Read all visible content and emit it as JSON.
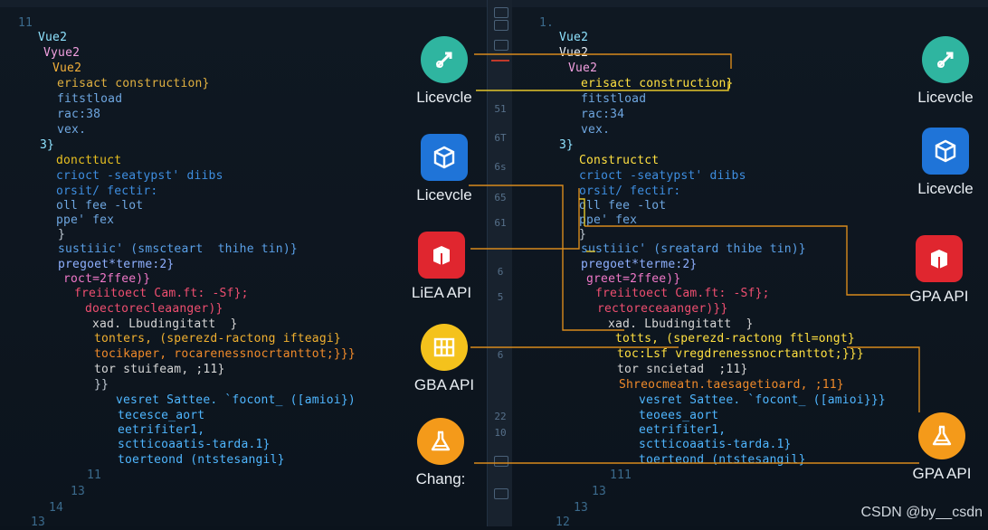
{
  "colors": {
    "background": "#0b131c",
    "orange_line": "#d88a1c",
    "yellow_line": "#e3c62a"
  },
  "left_code": [
    {
      "text": "11",
      "color": "#3b6a8c"
    },
    {
      "text": "Vue2",
      "color": "#8fe3ff"
    },
    {
      "text": "Vyue2",
      "color": "#f2a0e0"
    },
    {
      "text": "Vue2",
      "color": "#f5b13a"
    },
    {
      "text": "erisact construction}",
      "color": "#e0b040"
    },
    {
      "text": "fitstload",
      "color": "#6ea6e0"
    },
    {
      "text": "rac:38",
      "color": "#6ea6e0"
    },
    {
      "text": "vex.",
      "color": "#6ea6e0"
    },
    {
      "text": "3}",
      "color": "#8fe3ff"
    },
    {
      "text": "doncttuct",
      "color": "#e8c020"
    },
    {
      "text": "crioct -seatypst' diibs",
      "color": "#3e8ee0"
    },
    {
      "text": "orsit/ fectir:",
      "color": "#3e8ee0"
    },
    {
      "text": "oll fee -lot",
      "color": "#6ea6e0"
    },
    {
      "text": "ppe' fex",
      "color": "#6ea6e0"
    },
    {
      "text": "}",
      "color": "#bfc8d2"
    },
    {
      "text": "sustiiic' (smscteart  thihe tin)}",
      "color": "#5aa0e8"
    },
    {
      "text": "pregoet*terme:2}",
      "color": "#8fb0ff"
    },
    {
      "text": "roct=2ffee)}",
      "color": "#f078c8"
    },
    {
      "text": "freiitoect Cam.ft: -Sf};",
      "color": "#ef4f70"
    },
    {
      "text": "doectorecleaanger)}",
      "color": "#ef4f70"
    },
    {
      "text": "xad. Lbudingitatt  }",
      "color": "#d6d6d6"
    },
    {
      "text": "tonters, (sperezd-ractong ifteagi}",
      "color": "#f0b030"
    },
    {
      "text": "tocikaper, rocarenessnocrtanttot;}}}",
      "color": "#f08a2a"
    },
    {
      "text": "tor stuifeam, ;11}",
      "color": "#d6d6d6"
    },
    {
      "text": "}}",
      "color": "#bfc8d2"
    },
    {
      "text": "vesret Sattee. `focont_ ([amioi})",
      "color": "#4fb6ff"
    },
    {
      "text": "tecesce_aort",
      "color": "#4fb6ff"
    },
    {
      "text": "eetrifiter1,",
      "color": "#4fb6ff"
    },
    {
      "text": "sctticoaatis-tarda.1}",
      "color": "#4fb6ff"
    },
    {
      "text": "toerteond (ntstesangil}",
      "color": "#4fb6ff"
    },
    {
      "text": "11",
      "color": "#3b6a8c"
    },
    {
      "text": "13",
      "color": "#3b6a8c"
    },
    {
      "text": "14",
      "color": "#3b6a8c"
    },
    {
      "text": "13",
      "color": "#3b6a8c"
    }
  ],
  "right_code": [
    {
      "text": "1.",
      "color": "#3b6a8c"
    },
    {
      "text": "Vue2",
      "color": "#8fe3ff"
    },
    {
      "text": "Vue2",
      "color": "#e9eef3"
    },
    {
      "text": "Vue2",
      "color": "#f2a0e0"
    },
    {
      "text": "erisact construction}",
      "color": "#ffe040"
    },
    {
      "text": "fitstload",
      "color": "#6ea6e0"
    },
    {
      "text": "rac:34",
      "color": "#6ea6e0"
    },
    {
      "text": "vex.",
      "color": "#6ea6e0"
    },
    {
      "text": "3}",
      "color": "#8fe3ff"
    },
    {
      "text": "Constructct",
      "color": "#ffe040"
    },
    {
      "text": "crioct -seatypst' diibs",
      "color": "#3e8ee0"
    },
    {
      "text": "orsit/ fectir:",
      "color": "#3e8ee0"
    },
    {
      "text": "oll fee -lot",
      "color": "#6ea6e0"
    },
    {
      "text": "ppe' fex",
      "color": "#6ea6e0"
    },
    {
      "text": "}",
      "color": "#bfc8d2"
    },
    {
      "text": "sustiiic' (sreatard thibe tin)}",
      "color": "#5aa0e8"
    },
    {
      "text": "pregoet*terme:2}",
      "color": "#8fb0ff"
    },
    {
      "text": "greet=2ffee)}",
      "color": "#f078c8"
    },
    {
      "text": "freiitoect Cam.ft: -Sf};",
      "color": "#ef4f70"
    },
    {
      "text": "rectoreceaanger)}}",
      "color": "#ef4f70"
    },
    {
      "text": "xad. Lbudingitatt  }",
      "color": "#d6d6d6"
    },
    {
      "text": "totts, (sperezd-ractong ftl=ongt}",
      "color": "#ffe040"
    },
    {
      "text": "toc:Lsf vregdrenessnocrtanttot;}}}",
      "color": "#ffe040"
    },
    {
      "text": "tor sncietad  ;11}",
      "color": "#d6d6d6"
    },
    {
      "text": "Shreocmeatn.taesagetioard, ;11}",
      "color": "#f08a2a"
    },
    {
      "text": "vesret Sattee. `focont_ ([amioi}}}",
      "color": "#4fb6ff"
    },
    {
      "text": "teoees_aort",
      "color": "#4fb6ff"
    },
    {
      "text": "eetrifiter1,",
      "color": "#4fb6ff"
    },
    {
      "text": "sctticoaatis-tarda.1}",
      "color": "#4fb6ff"
    },
    {
      "text": "toerteond (ntstesangil}",
      "color": "#4fb6ff"
    },
    {
      "text": "111",
      "color": "#3b6a8c"
    },
    {
      "text": "13",
      "color": "#3b6a8c"
    },
    {
      "text": "13",
      "color": "#3b6a8c"
    },
    {
      "text": "12",
      "color": "#3b6a8c"
    }
  ],
  "gutter": {
    "numbers": [
      "51",
      "6T",
      "6s",
      "65",
      "61",
      "6",
      "5",
      "6",
      "22",
      "10"
    ]
  },
  "left_nodes": [
    {
      "label": "Licevcle",
      "icon": "link-icon",
      "color": "#2fb5a0"
    },
    {
      "label": "Licevcle",
      "icon": "cube-icon",
      "color": "#1f74d8"
    },
    {
      "label": "LiEA API",
      "icon": "box-icon",
      "color": "#e0262f"
    },
    {
      "label": "GBA API",
      "icon": "grid-icon",
      "color": "#f4c21c"
    },
    {
      "label": "Chang:",
      "icon": "flask-icon",
      "color": "#f49a1a"
    }
  ],
  "right_nodes": [
    {
      "label": "Licevcle",
      "icon": "link-icon",
      "color": "#2fb5a0"
    },
    {
      "label": "Licevcle",
      "icon": "cube-icon",
      "color": "#1f74d8"
    },
    {
      "label": "GPA API",
      "icon": "box-icon",
      "color": "#e0262f"
    },
    {
      "label": "GPA API",
      "icon": "flask-icon",
      "color": "#f49a1a"
    }
  ],
  "watermark": "CSDN @by__csdn"
}
